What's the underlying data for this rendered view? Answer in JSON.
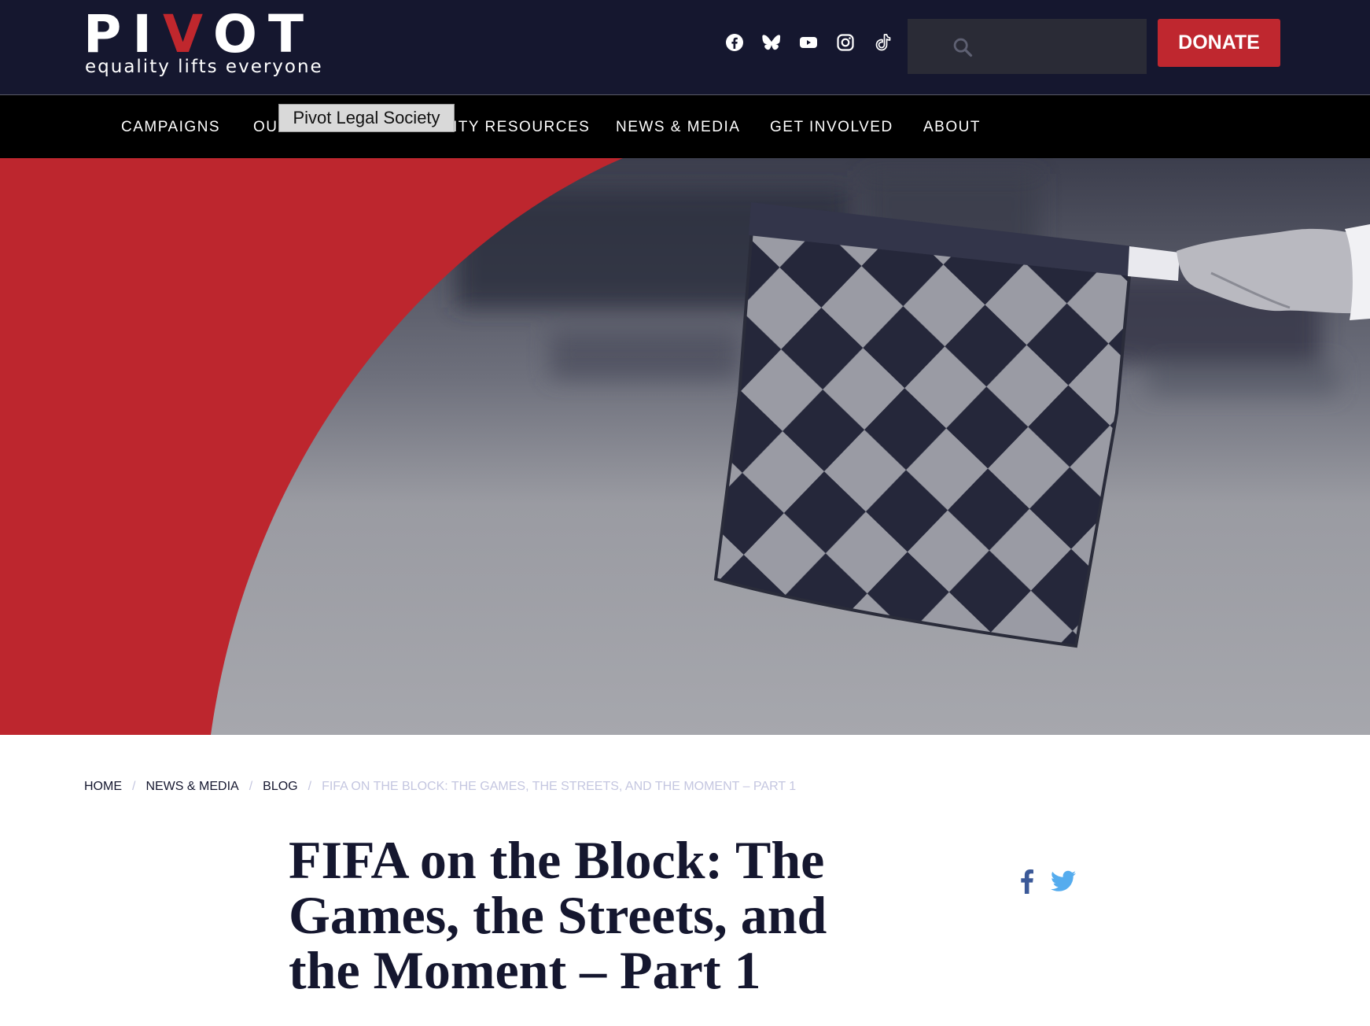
{
  "header": {
    "logo_word_start": "PI",
    "logo_word_accent": "V",
    "logo_word_end": "OT",
    "logo_tagline": "equality lifts everyone",
    "search": {
      "value": "",
      "placeholder": ""
    },
    "donate_label": "DONATE",
    "social_icons": [
      "facebook-icon",
      "bluesky-icon",
      "youtube-icon",
      "instagram-icon",
      "tiktok-icon"
    ]
  },
  "nav": {
    "items": [
      {
        "label": "CAMPAIGNS"
      },
      {
        "label": "OU"
      },
      {
        "label": "ITY RESOURCES"
      },
      {
        "label": "NEWS & MEDIA"
      },
      {
        "label": "GET INVOLVED"
      },
      {
        "label": "ABOUT"
      }
    ],
    "tooltip": "Pivot Legal Society"
  },
  "breadcrumb": {
    "items": [
      "HOME",
      "NEWS & MEDIA",
      "BLOG"
    ],
    "separator": "/",
    "current": "FIFA ON THE BLOCK: THE GAMES, THE STREETS, AND THE MOMENT – PART 1"
  },
  "article": {
    "title": "FIFA on the Block: The Games, the Streets, and the Moment – Part 1"
  },
  "share": {
    "icons": [
      "facebook-share-icon",
      "twitter-share-icon"
    ]
  },
  "colors": {
    "header_bg": "#15172f",
    "nav_bg": "#000000",
    "brand_red": "#bf272f",
    "title_text": "#15172f",
    "breadcrumb_current": "#c4c6e0",
    "facebook_share": "#3b5998",
    "twitter_share": "#55acee"
  }
}
